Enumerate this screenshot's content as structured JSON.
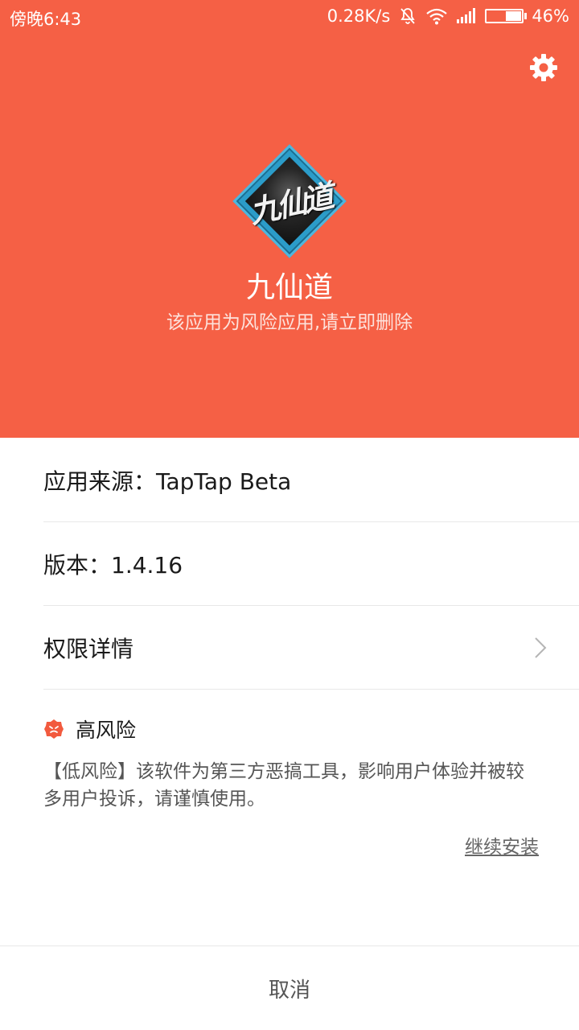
{
  "status_bar": {
    "time": "傍晚6:43",
    "net_speed": "0.28K/s",
    "battery_percent": "46%",
    "battery_level": 0.46
  },
  "app": {
    "name": "九仙道",
    "warning": "该应用为风险应用,请立即删除",
    "icon_text": "九仙道"
  },
  "info": {
    "source": "应用来源：TapTap Beta",
    "version": "版本：1.4.16",
    "permissions": "权限详情"
  },
  "risk": {
    "level": "高风险",
    "description": "【低风险】该软件为第三方恶搞工具，影响用户体验并被较多用户投诉，请谨慎使用。",
    "continue_label": "继续安装"
  },
  "footer": {
    "cancel_label": "取消"
  },
  "colors": {
    "hero_bg": "#f56045",
    "risk_red": "#f25a3e"
  },
  "icons": {
    "settings": "gear-icon",
    "chevron": "chevron-right-icon",
    "risk": "risk-badge-icon"
  }
}
